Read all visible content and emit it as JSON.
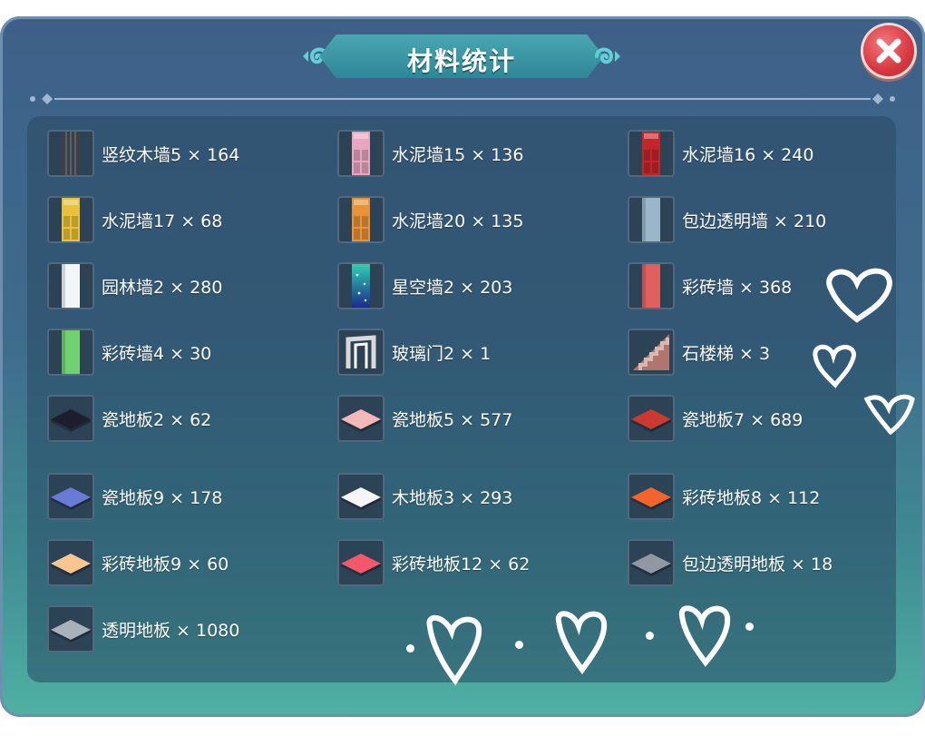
{
  "title": "材料统计",
  "close_icon": "close-x-icon",
  "items": [
    {
      "label": "竖纹木墙5 × 164",
      "icon": "wood-wall-icon",
      "color": "#3b3f46"
    },
    {
      "label": "水泥墙15 × 136",
      "icon": "wall-pink-icon",
      "color": "#e8a7be"
    },
    {
      "label": "水泥墙16 × 240",
      "icon": "wall-red-icon",
      "color": "#c2262b"
    },
    {
      "label": "水泥墙17 × 68",
      "icon": "wall-yellow-icon",
      "color": "#e8c23a"
    },
    {
      "label": "水泥墙20 × 135",
      "icon": "wall-orange-icon",
      "color": "#e8923a"
    },
    {
      "label": "包边透明墙 × 210",
      "icon": "glass-wall-icon",
      "color": "#9ab7c9"
    },
    {
      "label": "园林墙2 × 280",
      "icon": "white-wall-icon",
      "color": "#f3f6f6"
    },
    {
      "label": "星空墙2 × 203",
      "icon": "starry-wall-icon",
      "color": "#2fb9a9"
    },
    {
      "label": "彩砖墙 × 368",
      "icon": "red-brick-wall-icon",
      "color": "#e06060"
    },
    {
      "label": "彩砖墙4 × 30",
      "icon": "green-brick-wall-icon",
      "color": "#6fd16f"
    },
    {
      "label": "玻璃门2 × 1",
      "icon": "glass-door-icon",
      "color": "#d9d9d9"
    },
    {
      "label": "石楼梯 × 3",
      "icon": "stone-stairs-icon",
      "color": "#d9b8b0"
    },
    {
      "label": "瓷地板2 × 62",
      "icon": "black-tile-floor-icon",
      "color": "#1d1d2e"
    },
    {
      "label": "瓷地板5 × 577",
      "icon": "pink-tile-floor-icon",
      "color": "#f4b8b8"
    },
    {
      "label": "瓷地板7 × 689",
      "icon": "red-tile-floor-icon",
      "color": "#cc3a2f"
    },
    {
      "label": "瓷地板9 × 178",
      "icon": "blue-tile-floor-icon",
      "color": "#6a7bd6"
    },
    {
      "label": "木地板3 × 293",
      "icon": "white-wood-floor-icon",
      "color": "#f5f5f5"
    },
    {
      "label": "彩砖地板8 × 112",
      "icon": "orange-tile-floor-icon",
      "color": "#f2642c"
    },
    {
      "label": "彩砖地板9 × 60",
      "icon": "peach-tile-floor-icon",
      "color": "#f6c590"
    },
    {
      "label": "彩砖地板12 × 62",
      "icon": "coral-tile-floor-icon",
      "color": "#f2576a"
    },
    {
      "label": "包边透明地板 × 18",
      "icon": "gray-glass-floor-icon",
      "color": "#8f98a3"
    },
    {
      "label": "透明地板 × 1080",
      "icon": "glass-floor-icon",
      "color": "#a9b1ba"
    }
  ],
  "decorations": "hand-drawn-heart-icon"
}
